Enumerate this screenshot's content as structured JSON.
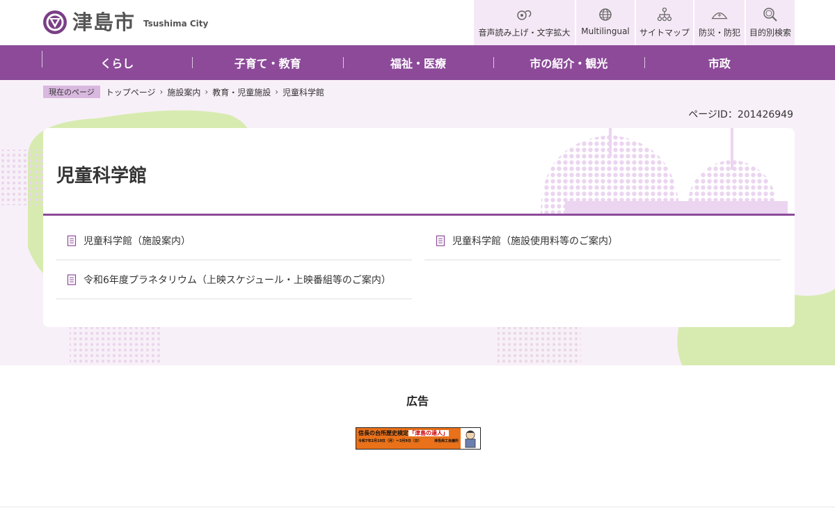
{
  "header": {
    "site_name": "津島市",
    "site_name_en": "Tsushima City",
    "utility_links": [
      {
        "label": "音声読み上げ・文字拡大",
        "icon": "speech-icon"
      },
      {
        "label": "Multilingual",
        "icon": "globe-icon"
      },
      {
        "label": "サイトマップ",
        "icon": "sitemap-icon"
      },
      {
        "label": "防災・防犯",
        "icon": "disaster-icon"
      },
      {
        "label": "目的別検索",
        "icon": "search-icon"
      }
    ]
  },
  "nav": {
    "items": [
      "くらし",
      "子育て・教育",
      "福祉・医療",
      "市の紹介・観光",
      "市政"
    ]
  },
  "breadcrumb": {
    "label": "現在のページ",
    "items": [
      "トップページ",
      "施設案内",
      "教育・児童施設",
      "児童科学館"
    ]
  },
  "page": {
    "id_text": "ページID：201426949",
    "title": "児童科学館",
    "links": [
      {
        "label": "児童科学館（施設案内）"
      },
      {
        "label": "児童科学館（施設使用料等のご案内）"
      },
      {
        "label": "令和6年度プラネタリウム（上映スケジュール・上映番組等のご案内）"
      }
    ]
  },
  "ads": {
    "heading": "広告",
    "banner": {
      "line1": "信長の台所歴史検定",
      "line1_highlight": "「津島の達人」",
      "line2_left": "令和7年2月10日（月）～3月9日（日）",
      "line2_right": "津島商工会議所"
    }
  },
  "colors": {
    "brand_purple": "#8c4a99",
    "utility_bg": "#f5e8f6",
    "main_bg": "#f8f0f8",
    "accent_green": "#d7ebb0"
  }
}
